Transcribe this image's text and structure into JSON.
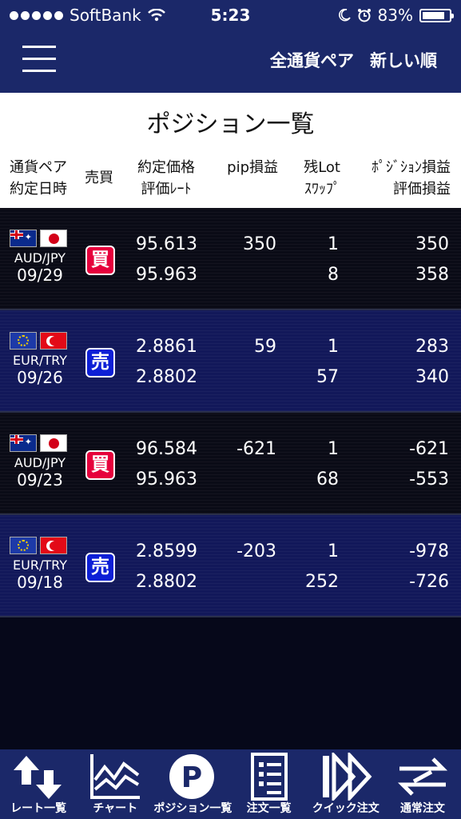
{
  "status_bar": {
    "carrier": "SoftBank",
    "time": "5:23",
    "battery": "83%",
    "battery_level": 0.83
  },
  "header": {
    "pair_filter": "全通貨ペア",
    "sort": "新しい順"
  },
  "page": {
    "title": "ポジション一覧"
  },
  "columns": {
    "pair_line1": "通貨ペア",
    "pair_line2": "約定日時",
    "side": "売買",
    "price_line1": "約定価格",
    "price_line2": "評価ﾚｰﾄ",
    "pip": "pip損益",
    "lot_line1": "残Lot",
    "lot_line2": "ｽﾜｯﾌﾟ",
    "pl_line1": "ﾎﾟｼﾞｼｮﾝ損益",
    "pl_line2": "評価損益"
  },
  "positions": [
    {
      "pair": "AUD/JPY",
      "date": "09/29",
      "side": "買",
      "side_type": "buy",
      "flag1": "au",
      "flag2": "jp",
      "entry_price": "95.613",
      "eval_rate": "95.963",
      "pip": "350",
      "lot": "1",
      "swap": "8",
      "position_pl": "350",
      "eval_pl": "358"
    },
    {
      "pair": "EUR/TRY",
      "date": "09/26",
      "side": "売",
      "side_type": "sell",
      "flag1": "eu",
      "flag2": "tr",
      "entry_price": "2.8861",
      "eval_rate": "2.8802",
      "pip": "59",
      "lot": "1",
      "swap": "57",
      "position_pl": "283",
      "eval_pl": "340"
    },
    {
      "pair": "AUD/JPY",
      "date": "09/23",
      "side": "買",
      "side_type": "buy",
      "flag1": "au",
      "flag2": "jp",
      "entry_price": "96.584",
      "eval_rate": "95.963",
      "pip": "-621",
      "lot": "1",
      "swap": "68",
      "position_pl": "-621",
      "eval_pl": "-553"
    },
    {
      "pair": "EUR/TRY",
      "date": "09/18",
      "side": "売",
      "side_type": "sell",
      "flag1": "eu",
      "flag2": "tr",
      "entry_price": "2.8599",
      "eval_rate": "2.8802",
      "pip": "-203",
      "lot": "1",
      "swap": "252",
      "position_pl": "-978",
      "eval_pl": "-726"
    }
  ],
  "tabs": [
    {
      "label": "レート一覧",
      "icon": "rate-list-icon"
    },
    {
      "label": "チャート",
      "icon": "chart-icon"
    },
    {
      "label": "ポジション一覧",
      "icon": "position-icon"
    },
    {
      "label": "注文一覧",
      "icon": "order-list-icon"
    },
    {
      "label": "クイック注文",
      "icon": "quick-order-icon"
    },
    {
      "label": "通常注文",
      "icon": "normal-order-icon"
    }
  ],
  "colors": {
    "header_bg": "#1b2869",
    "buy": "#e6003c",
    "sell": "#0d1fd6",
    "row_dark": "#0a0b16",
    "row_blue": "#12185a"
  }
}
